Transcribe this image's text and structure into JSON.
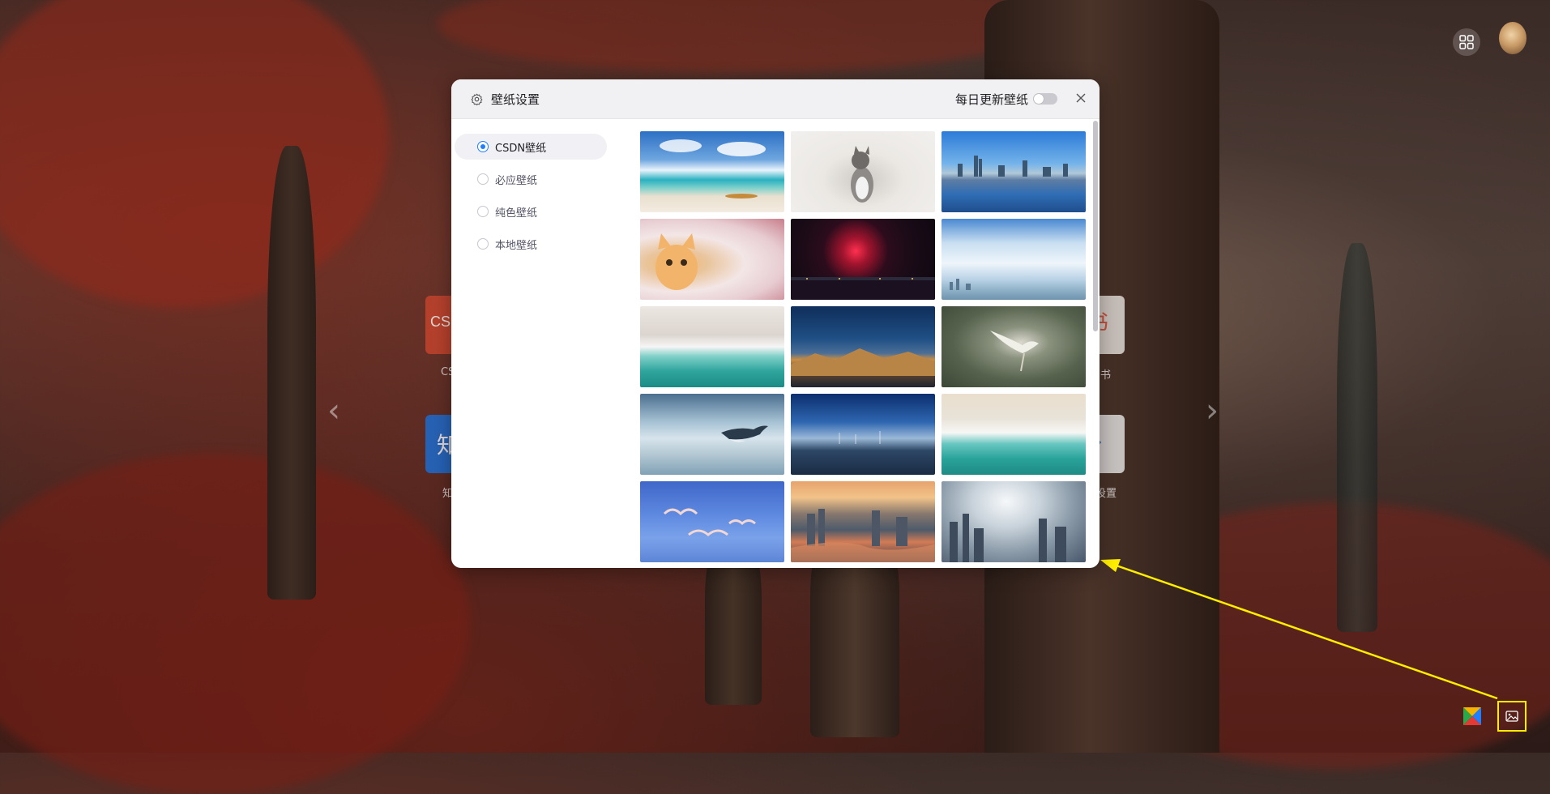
{
  "background": {
    "tiles": [
      {
        "text": "CS",
        "color": "#c8452e"
      },
      {
        "text": "CS",
        "color": "#c8452e"
      },
      {
        "text": "知",
        "color": "#1a6fd8"
      },
      {
        "text": "知",
        "color": "#1a6fd8"
      },
      {
        "text": "书",
        "color": "#e05a45"
      },
      {
        "text": "书",
        "color": "#e05a45"
      },
      {
        "text": "设置",
        "color": "#cccccc"
      }
    ],
    "nav_left": "‹",
    "nav_right": "›"
  },
  "top_right": {
    "apps_icon": "grid-apps-icon",
    "avatar": "avatar"
  },
  "bottom_right": {
    "brand_icon": "colorful-x-logo-icon",
    "wallpaper_icon": "image-icon"
  },
  "annotation": {
    "arrow_color": "#ffee00"
  },
  "dialog": {
    "title": "壁纸设置",
    "settings_icon": "gear-icon",
    "daily_update_label": "每日更新壁纸",
    "daily_update_on": false,
    "close_icon": "close-icon",
    "sources": [
      {
        "label": "CSDN壁纸",
        "selected": true
      },
      {
        "label": "必应壁纸",
        "selected": false
      },
      {
        "label": "纯色壁纸",
        "selected": false
      },
      {
        "label": "本地壁纸",
        "selected": false
      }
    ],
    "accent_color": "#1e80ff",
    "wallpapers": [
      {
        "subject": "beach"
      },
      {
        "subject": "cat"
      },
      {
        "subject": "city-skyline"
      },
      {
        "subject": "kitten"
      },
      {
        "subject": "fireworks"
      },
      {
        "subject": "clouds"
      },
      {
        "subject": "wave-shore"
      },
      {
        "subject": "mountain"
      },
      {
        "subject": "bird"
      },
      {
        "subject": "whale"
      },
      {
        "subject": "harbor"
      },
      {
        "subject": "wave-aerial"
      },
      {
        "subject": "seagulls"
      },
      {
        "subject": "sunset-city"
      },
      {
        "subject": "foggy-city"
      }
    ]
  }
}
